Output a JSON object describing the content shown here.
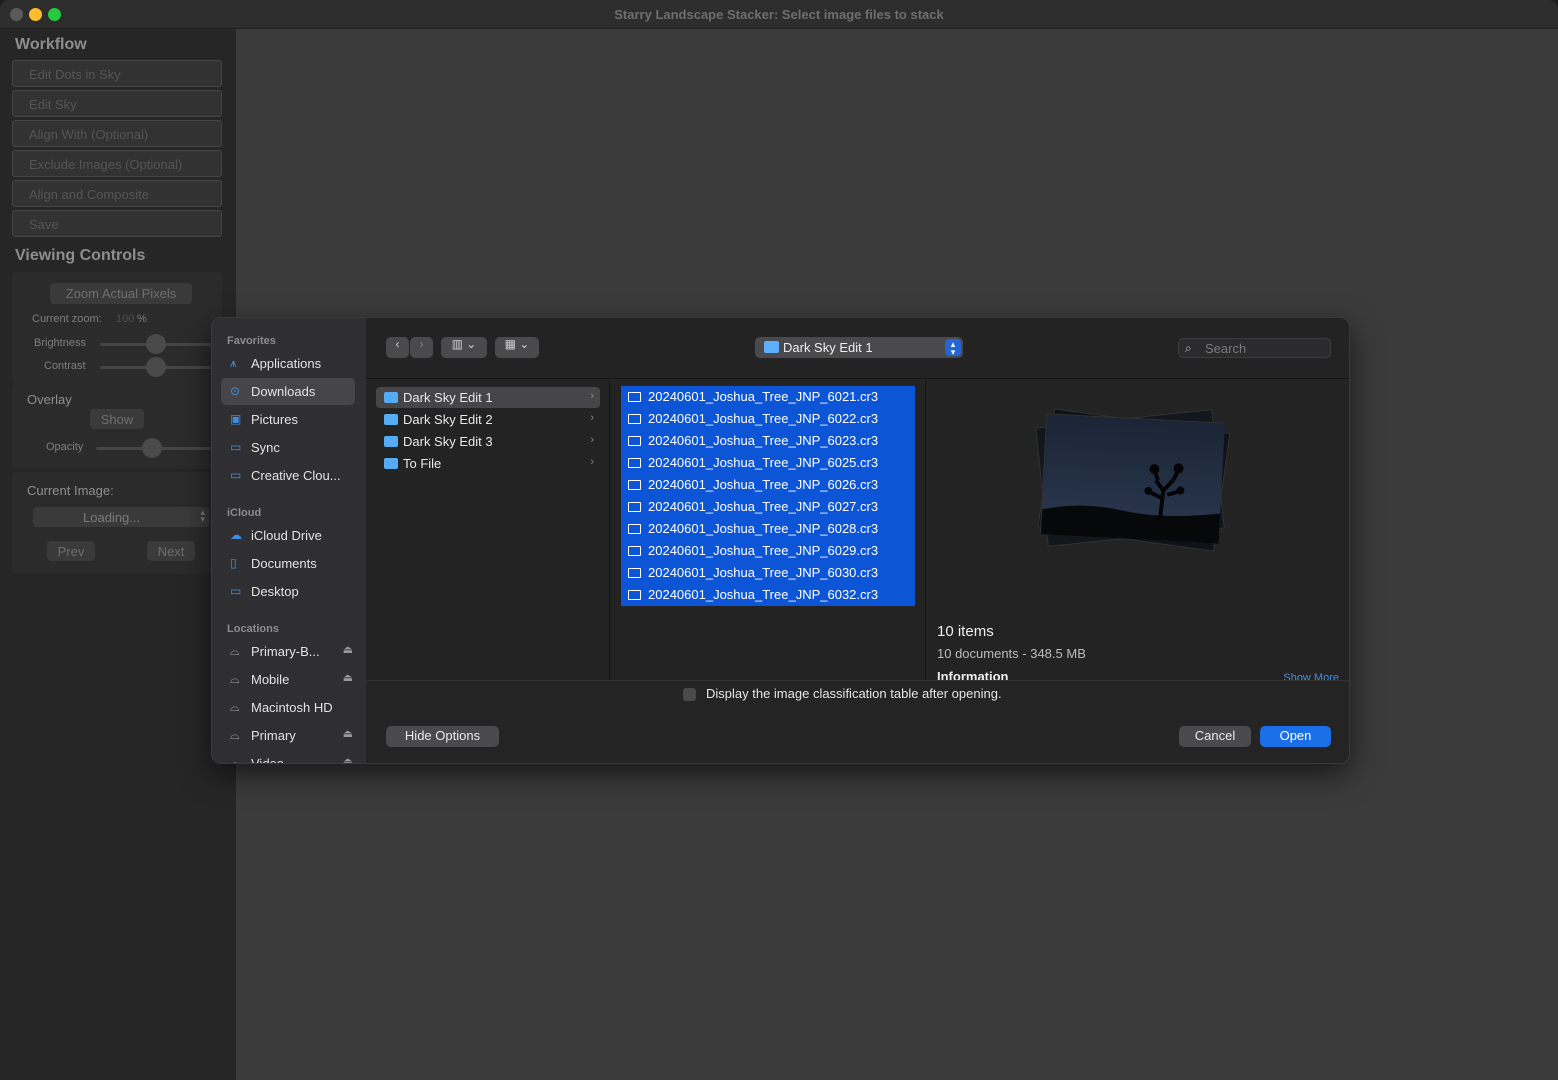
{
  "window": {
    "title": "Starry Landscape Stacker: Select image files to stack"
  },
  "workflow": {
    "title": "Workflow",
    "buttons": [
      "Edit Dots in Sky",
      "Edit Sky",
      "Align With (Optional)",
      "Exclude Images (Optional)",
      "Align and Composite",
      "Save"
    ]
  },
  "viewing": {
    "title": "Viewing Controls",
    "zoom_button": "Zoom Actual Pixels",
    "current_zoom_label": "Current zoom:",
    "current_zoom_value": "100",
    "current_zoom_unit": "%",
    "brightness_label": "Brightness",
    "contrast_label": "Contrast",
    "overlay_label": "Overlay",
    "show_button": "Show",
    "opacity_label": "Opacity",
    "current_image_label": "Current Image:",
    "current_image_value": "Loading...",
    "prev_button": "Prev",
    "next_button": "Next"
  },
  "dialog": {
    "sidebar": {
      "favorites_head": "Favorites",
      "favorites": [
        {
          "label": "Applications",
          "icon": "applications-icon"
        },
        {
          "label": "Downloads",
          "icon": "downloads-icon",
          "selected": true
        },
        {
          "label": "Pictures",
          "icon": "pictures-icon"
        },
        {
          "label": "Sync",
          "icon": "folder-icon"
        },
        {
          "label": "Creative Clou...",
          "icon": "folder-icon"
        }
      ],
      "icloud_head": "iCloud",
      "icloud": [
        {
          "label": "iCloud Drive",
          "icon": "cloud-icon"
        },
        {
          "label": "Documents",
          "icon": "document-icon"
        },
        {
          "label": "Desktop",
          "icon": "desktop-icon"
        }
      ],
      "locations_head": "Locations",
      "locations": [
        {
          "label": "Primary-B...",
          "icon": "drive-icon",
          "eject": true
        },
        {
          "label": "Mobile",
          "icon": "drive-icon",
          "eject": true
        },
        {
          "label": "Macintosh HD",
          "icon": "drive-icon",
          "eject": false
        },
        {
          "label": "Primary",
          "icon": "drive-icon",
          "eject": true
        },
        {
          "label": "Video",
          "icon": "drive-icon",
          "eject": true
        }
      ]
    },
    "path_popup": "Dark Sky Edit 1",
    "search_placeholder": "Search",
    "folders": [
      "Dark Sky Edit 1",
      "Dark Sky Edit 2",
      "Dark Sky Edit 3",
      "To File"
    ],
    "files": [
      "20240601_Joshua_Tree_JNP_6021.cr3",
      "20240601_Joshua_Tree_JNP_6022.cr3",
      "20240601_Joshua_Tree_JNP_6023.cr3",
      "20240601_Joshua_Tree_JNP_6025.cr3",
      "20240601_Joshua_Tree_JNP_6026.cr3",
      "20240601_Joshua_Tree_JNP_6027.cr3",
      "20240601_Joshua_Tree_JNP_6028.cr3",
      "20240601_Joshua_Tree_JNP_6029.cr3",
      "20240601_Joshua_Tree_JNP_6030.cr3",
      "20240601_Joshua_Tree_JNP_6032.cr3"
    ],
    "preview": {
      "title": "10 items",
      "subtitle": "10 documents - 348.5 MB",
      "info_label": "Information",
      "show_more": "Show More"
    },
    "options_checkbox": "Display the image classification table after opening.",
    "hide_options": "Hide Options",
    "cancel": "Cancel",
    "open": "Open"
  },
  "colors": {
    "accent": "#0c55d6",
    "open_button": "#1a6fe6"
  }
}
